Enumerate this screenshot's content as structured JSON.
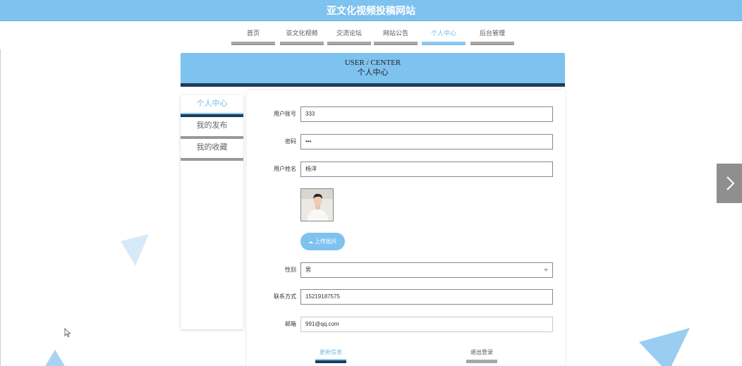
{
  "site": {
    "title": "亚文化视频投稿网站"
  },
  "nav": {
    "items": [
      {
        "label": "首页",
        "active": false
      },
      {
        "label": "亚文化视频",
        "active": false
      },
      {
        "label": "交流论坛",
        "active": false
      },
      {
        "label": "网站公告",
        "active": false
      },
      {
        "label": "个人中心",
        "active": true
      },
      {
        "label": "后台管理",
        "active": false
      }
    ]
  },
  "banner": {
    "en": "USER / CENTER",
    "cn": "个人中心"
  },
  "sidebar": {
    "items": [
      {
        "label": "个人中心",
        "active": true
      },
      {
        "label": "我的发布",
        "active": false
      },
      {
        "label": "我的收藏",
        "active": false
      }
    ]
  },
  "form": {
    "account": {
      "label": "用户账号",
      "value": "333"
    },
    "password": {
      "label": "密码",
      "value": "•••"
    },
    "name": {
      "label": "用户姓名",
      "value": "杨洋"
    },
    "upload_label": "上传图片",
    "gender": {
      "label": "性别",
      "value": "男"
    },
    "phone": {
      "label": "联系方式",
      "value": "15219187575"
    },
    "email": {
      "label": "邮箱",
      "value": "991@qq.com"
    },
    "update_label": "更新信息",
    "logout_label": "退出登录"
  },
  "colors": {
    "accent": "#7ec2ef",
    "dark": "#1c3d5f",
    "gray_bar": "#a7a7a7"
  }
}
